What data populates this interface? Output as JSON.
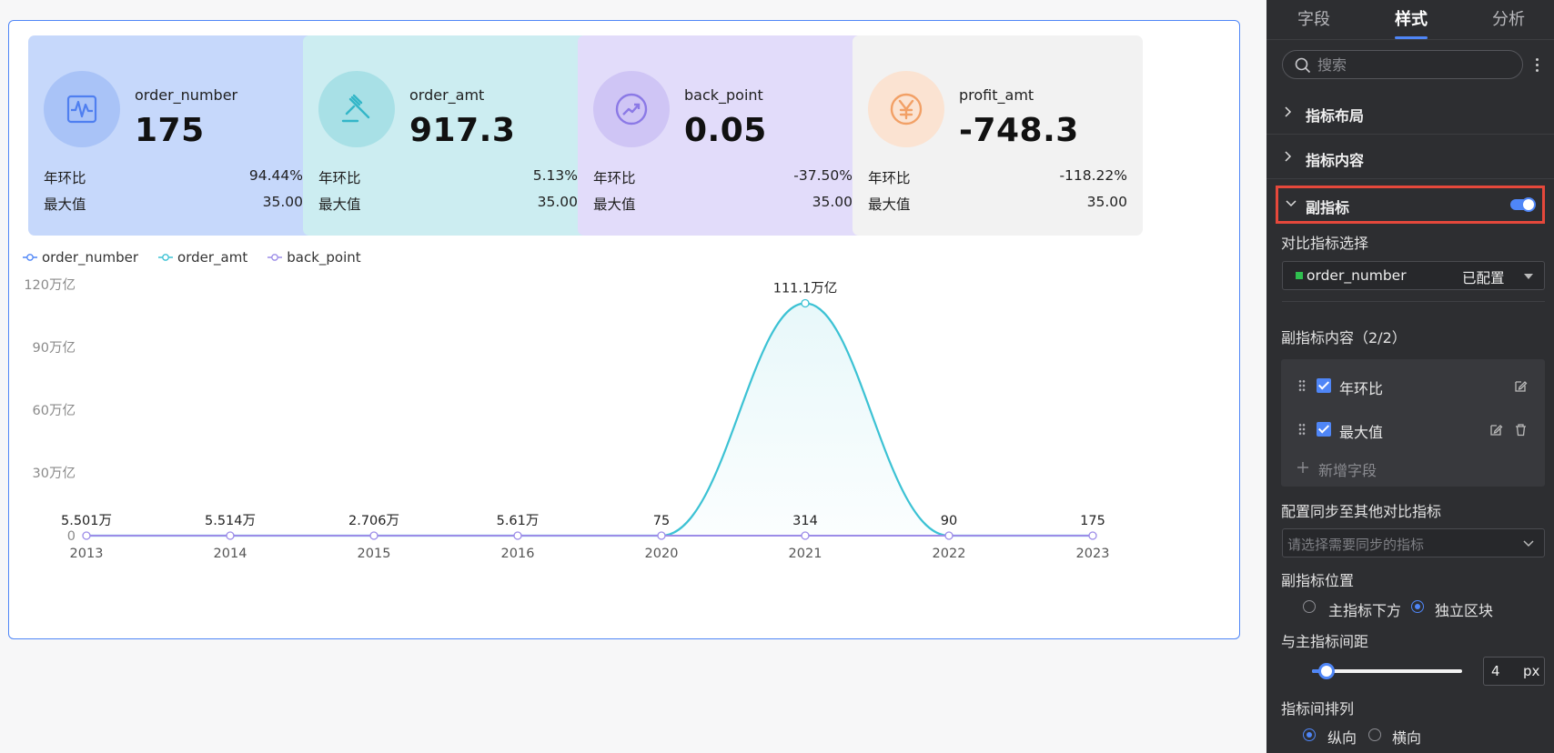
{
  "kpis": [
    {
      "name": "order_number",
      "value": "175",
      "row1_label": "年环比",
      "row1_value": "94.44%",
      "row2_label": "最大值",
      "row2_value": "35.00",
      "bg": "#c6d8fb",
      "circle": "#a9c3f7",
      "icon_color": "#4f7ff0",
      "icon": "pulse-icon"
    },
    {
      "name": "order_amt",
      "value": "917.3",
      "row1_label": "年环比",
      "row1_value": "5.13%",
      "row2_label": "最大值",
      "row2_value": "35.00",
      "bg": "#ccedf1",
      "circle": "#a8e0e6",
      "icon_color": "#33b6c8",
      "icon": "hammer-icon"
    },
    {
      "name": "back_point",
      "value": "0.05",
      "row1_label": "年环比",
      "row1_value": "-37.50%",
      "row2_label": "最大值",
      "row2_value": "35.00",
      "bg": "#e2dcfa",
      "circle": "#cfc5f5",
      "icon_color": "#8b79e6",
      "icon": "trend-up-icon"
    },
    {
      "name": "profit_amt",
      "value": "-748.3",
      "row1_label": "年环比",
      "row1_value": "-118.22%",
      "row2_label": "最大值",
      "row2_value": "35.00",
      "bg": "#f2f2f2",
      "circle": "#fbe3d2",
      "icon_color": "#f2a066",
      "icon": "yen-icon"
    }
  ],
  "legend": [
    {
      "name": "order_number",
      "color": "#4f86f7"
    },
    {
      "name": "order_amt",
      "color": "#3cc2d4"
    },
    {
      "name": "back_point",
      "color": "#9c8ce8"
    }
  ],
  "chart_data": {
    "type": "line",
    "categories": [
      "2013",
      "2014",
      "2015",
      "2016",
      "2020",
      "2021",
      "2022",
      "2023"
    ],
    "y_ticks": [
      "0",
      "30万亿",
      "60万亿",
      "90万亿",
      "120万亿"
    ],
    "ylim": [
      0,
      120
    ],
    "series": [
      {
        "name": "order_number",
        "color": "#4f86f7",
        "values": [
          0,
          0,
          0,
          0,
          0,
          0,
          0,
          0
        ]
      },
      {
        "name": "order_amt",
        "color": "#3cc2d4",
        "values": [
          0,
          0,
          0,
          0,
          0,
          111.1,
          0,
          0
        ],
        "area": true,
        "labels": [
          "5.501万",
          "5.514万",
          "2.706万",
          "5.61万",
          "75",
          "111.1万亿",
          "90",
          "175"
        ],
        "under_labels": [
          "5.501万",
          "5.514万",
          "2.706万",
          "5.61万",
          "75",
          "314",
          "90",
          "175"
        ]
      },
      {
        "name": "back_point",
        "color": "#9c8ce8",
        "values": [
          0,
          0,
          0,
          0,
          0,
          0,
          0,
          0
        ]
      }
    ],
    "peak_label": "111.1万亿"
  },
  "panel": {
    "tabs": [
      "字段",
      "样式",
      "分析"
    ],
    "active_tab": "样式",
    "search_placeholder": "搜索",
    "sections": [
      "指标布局",
      "指标内容",
      "副指标"
    ],
    "compare_label": "对比指标选择",
    "compare_value": "order_number",
    "compare_status": "已配置",
    "compare_color": "#2fbf4f",
    "sub_content_label": "副指标内容（2/2）",
    "sub_items": [
      "年环比",
      "最大值"
    ],
    "add_field": "新增字段",
    "sync_label": "配置同步至其他对比指标",
    "sync_placeholder": "请选择需要同步的指标",
    "position_label": "副指标位置",
    "position_options": [
      "主指标下方",
      "独立区块"
    ],
    "position_selected": "独立区块",
    "spacing_label": "与主指标间距",
    "spacing_value": "4",
    "spacing_unit": "px",
    "arrange_label": "指标间排列",
    "arrange_options": [
      "纵向",
      "横向"
    ],
    "arrange_selected": "纵向"
  }
}
